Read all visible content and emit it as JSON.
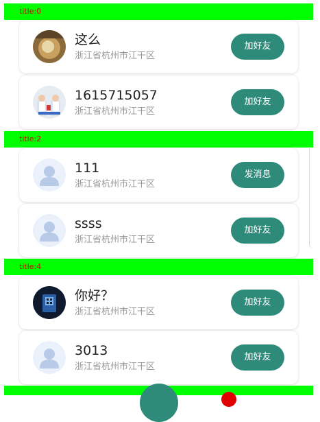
{
  "colors": {
    "header_background": "#00ff00",
    "header_text": "#d40000",
    "button_background": "#2e8b7a",
    "button_text": "#ffffff",
    "name_text": "#222222",
    "location_text": "#999999",
    "badge": "#e00000"
  },
  "sections": [
    {
      "title": "title:0",
      "users": [
        {
          "name": "这么",
          "location": "浙江省杭州市江干区",
          "action": "加好友",
          "avatar": "photo-avatar"
        },
        {
          "name": "1615715057",
          "location": "浙江省杭州市江干区",
          "action": "加好友",
          "avatar": "photo-avatar"
        }
      ]
    },
    {
      "title": "title:2",
      "users": [
        {
          "name": "111",
          "location": "浙江省杭州市江干区",
          "action": "发消息",
          "avatar": "default-user-avatar"
        },
        {
          "name": "ssss",
          "location": "浙江省杭州市江干区",
          "action": "加好友",
          "avatar": "default-user-avatar"
        }
      ]
    },
    {
      "title": "title:4",
      "users": [
        {
          "name": "你好？",
          "location": "浙江省杭州市江干区",
          "action": "加好友",
          "avatar": "photo-avatar"
        },
        {
          "name": "3013",
          "location": "浙江省杭州市江干区",
          "action": "加好友",
          "avatar": "default-user-avatar"
        }
      ]
    }
  ]
}
